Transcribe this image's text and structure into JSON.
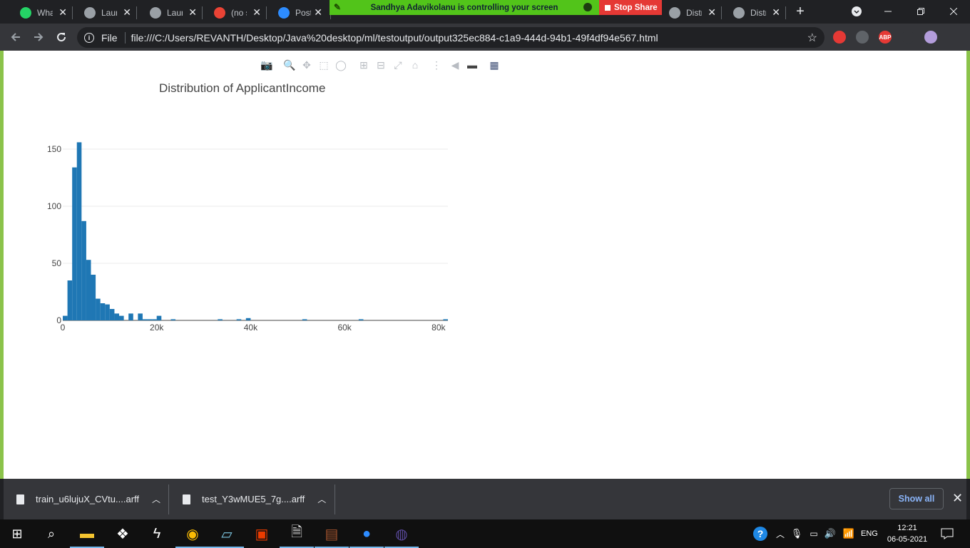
{
  "tabs": [
    {
      "title": "WhatsApp",
      "icon": "whatsapp-icon",
      "color": "#25d366"
    },
    {
      "title": "Launch",
      "icon": "globe-icon",
      "color": "#9aa0a6"
    },
    {
      "title": "Launch",
      "icon": "globe-icon",
      "color": "#9aa0a6"
    },
    {
      "title": "(no subject)",
      "icon": "gmail-icon",
      "color": "#ea4335"
    },
    {
      "title": "Post",
      "icon": "zoom-icon",
      "color": "#2d8cff"
    },
    {
      "title": "Distribution",
      "icon": "globe-icon",
      "color": "#9aa0a6"
    },
    {
      "title": "Distribution",
      "icon": "globe-icon",
      "color": "#9aa0a6"
    }
  ],
  "share_banner": {
    "text": "Sandhya Adavikolanu is controlling your screen",
    "stop_label": "Stop Share"
  },
  "omnibox": {
    "scheme": "File",
    "url": "file:///C:/Users/REVANTH/Desktop/Java%20desktop/ml/testoutput/output325ec884-c1a9-444d-94b1-49f4df94e567.html"
  },
  "extensions": [
    {
      "name": "hand-extension-icon",
      "color": "#e53935",
      "label": ""
    },
    {
      "name": "globe-extension-icon",
      "color": "#5f6368",
      "label": ""
    },
    {
      "name": "adblock-icon",
      "color": "#e53935",
      "label": "ABP"
    },
    {
      "name": "puzzle-icon",
      "color": "#35363a",
      "label": ""
    },
    {
      "name": "profile-avatar",
      "color": "#b39ddb",
      "label": ""
    }
  ],
  "chart_data": {
    "type": "bar",
    "title": "Distribution of ApplicantIncome",
    "xlabel": "",
    "ylabel": "",
    "bin_width": 1000,
    "x_start": 0,
    "x_ticks": [
      0,
      20000,
      40000,
      60000,
      80000
    ],
    "x_tick_labels": [
      "0",
      "20k",
      "40k",
      "60k",
      "80k"
    ],
    "y_ticks": [
      0,
      50,
      100,
      150
    ],
    "y_tick_labels": [
      "0",
      "50",
      "100",
      "150"
    ],
    "xlim": [
      0,
      82000
    ],
    "ylim": [
      0,
      160
    ],
    "grid": "horizontal",
    "color": "#1f77b4",
    "bins": [
      {
        "x": 0,
        "y": 4
      },
      {
        "x": 1000,
        "y": 35
      },
      {
        "x": 2000,
        "y": 134
      },
      {
        "x": 3000,
        "y": 156
      },
      {
        "x": 4000,
        "y": 87
      },
      {
        "x": 5000,
        "y": 53
      },
      {
        "x": 6000,
        "y": 40
      },
      {
        "x": 7000,
        "y": 19
      },
      {
        "x": 8000,
        "y": 15
      },
      {
        "x": 9000,
        "y": 14
      },
      {
        "x": 10000,
        "y": 10
      },
      {
        "x": 11000,
        "y": 6
      },
      {
        "x": 12000,
        "y": 4
      },
      {
        "x": 14000,
        "y": 6
      },
      {
        "x": 16000,
        "y": 6
      },
      {
        "x": 17000,
        "y": 1
      },
      {
        "x": 18000,
        "y": 1
      },
      {
        "x": 19000,
        "y": 1
      },
      {
        "x": 20000,
        "y": 4
      },
      {
        "x": 23000,
        "y": 1
      },
      {
        "x": 33000,
        "y": 1
      },
      {
        "x": 37000,
        "y": 1
      },
      {
        "x": 39000,
        "y": 2
      },
      {
        "x": 51000,
        "y": 1
      },
      {
        "x": 63000,
        "y": 1
      },
      {
        "x": 81000,
        "y": 1
      }
    ]
  },
  "modebar": [
    "camera-icon",
    "zoom-icon",
    "pan-icon",
    "box-select-icon",
    "lasso-icon",
    "zoom-in-icon",
    "zoom-out-icon",
    "autoscale-icon",
    "reset-axes-icon",
    "spike-lines-icon",
    "hover-closest-icon",
    "hover-compare-icon",
    "plotly-logo-icon"
  ],
  "downloads": [
    {
      "name": "train_u6lujuX_CVtu....arff"
    },
    {
      "name": "test_Y3wMUE5_7g....arff"
    }
  ],
  "show_all_label": "Show all",
  "taskbar": {
    "apps": [
      "start-icon",
      "search-icon",
      "file-explorer-icon",
      "dropbox-icon",
      "bolt-app-icon",
      "chrome-icon",
      "notepad-icon",
      "office-icon",
      "python-file-icon",
      "winrar-icon",
      "zoom-app-icon",
      "eclipse-icon"
    ],
    "language": "ENG",
    "time": "12:21",
    "date": "06-05-2021"
  }
}
